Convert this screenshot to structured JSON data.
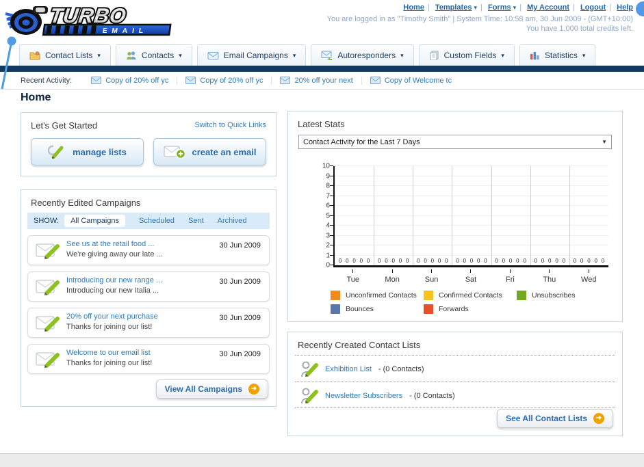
{
  "header": {
    "nav": [
      {
        "label": "Home"
      },
      {
        "label": "Templates"
      },
      {
        "label": "Forms"
      },
      {
        "label": "My Account"
      },
      {
        "label": "Logout"
      },
      {
        "label": "Help"
      }
    ],
    "login_info": "You are logged in as \"Timothy Smith\" | System Time: 10:58 am, 30 Jun 2009 - (GMT+10:00)",
    "credits": "You have 1,000 total credits left."
  },
  "tabs": [
    {
      "label": "Contact Lists"
    },
    {
      "label": "Contacts"
    },
    {
      "label": "Email Campaigns"
    },
    {
      "label": "Autoresponders"
    },
    {
      "label": "Custom Fields"
    },
    {
      "label": "Statistics"
    }
  ],
  "recent_activity": {
    "label": "Recent Activity:",
    "items": [
      {
        "label": "Copy of 20% off yc"
      },
      {
        "label": "Copy of 20% off yc"
      },
      {
        "label": "20% off your next"
      },
      {
        "label": "Copy of Welcome tc"
      }
    ]
  },
  "page_title": "Home",
  "get_started": {
    "title": "Let's Get Started",
    "switch_link": "Switch to Quick Links",
    "manage_lists": "manage lists",
    "create_email": "create an email"
  },
  "campaigns": {
    "title": "Recently Edited Campaigns",
    "filter_label": "SHOW:",
    "filters": [
      {
        "label": "All Campaigns"
      },
      {
        "label": "Scheduled"
      },
      {
        "label": "Sent"
      },
      {
        "label": "Archived"
      }
    ],
    "items": [
      {
        "title": "See us at the retail food ...",
        "subtitle": "We're giving away our late ...",
        "date": "30 Jun 2009"
      },
      {
        "title": "Introducing our new range ...",
        "subtitle": "Introducing our new Italia ...",
        "date": "30 Jun 2009"
      },
      {
        "title": "20% off your next purchase",
        "subtitle": "Thanks for joining our list!",
        "date": "30 Jun 2009"
      },
      {
        "title": "Welcome to our email list",
        "subtitle": "Thanks for joining our list!",
        "date": "30 Jun 2009"
      }
    ],
    "view_all": "View All Campaigns"
  },
  "stats": {
    "title": "Latest Stats",
    "period": "Contact Activity for the Last 7 Days",
    "chart_data": {
      "type": "bar",
      "title": "Contact Activity for the Last 7 Days",
      "categories": [
        "Tue",
        "Mon",
        "Sun",
        "Sat",
        "Fri",
        "Thu",
        "Wed"
      ],
      "series": [
        {
          "name": "Unconfirmed Contacts",
          "color": "#f28b1d",
          "values": [
            0,
            0,
            0,
            0,
            0,
            0,
            0
          ]
        },
        {
          "name": "Confirmed Contacts",
          "color": "#f6c31c",
          "values": [
            0,
            0,
            0,
            0,
            0,
            0,
            0
          ]
        },
        {
          "name": "Unsubscribes",
          "color": "#73a823",
          "values": [
            0,
            0,
            0,
            0,
            0,
            0,
            0
          ]
        },
        {
          "name": "Bounces",
          "color": "#5a76ab",
          "values": [
            0,
            0,
            0,
            0,
            0,
            0,
            0
          ]
        },
        {
          "name": "Forwards",
          "color": "#e8502b",
          "values": [
            0,
            0,
            0,
            0,
            0,
            0,
            0
          ]
        }
      ],
      "ylim": [
        0,
        10
      ],
      "yticks": [
        0,
        1,
        2,
        3,
        4,
        5,
        6,
        7,
        8,
        9,
        10
      ],
      "xlabel": "",
      "ylabel": "",
      "grid": true,
      "legend_position": "bottom"
    }
  },
  "contact_lists": {
    "title": "Recently Created Contact Lists",
    "items": [
      {
        "name": "Exhibition List",
        "suffix": "- (0 Contacts)"
      },
      {
        "name": "Newsletter Subscribers",
        "suffix": "- (0 Contacts)"
      }
    ],
    "see_all": "See All Contact Lists"
  }
}
